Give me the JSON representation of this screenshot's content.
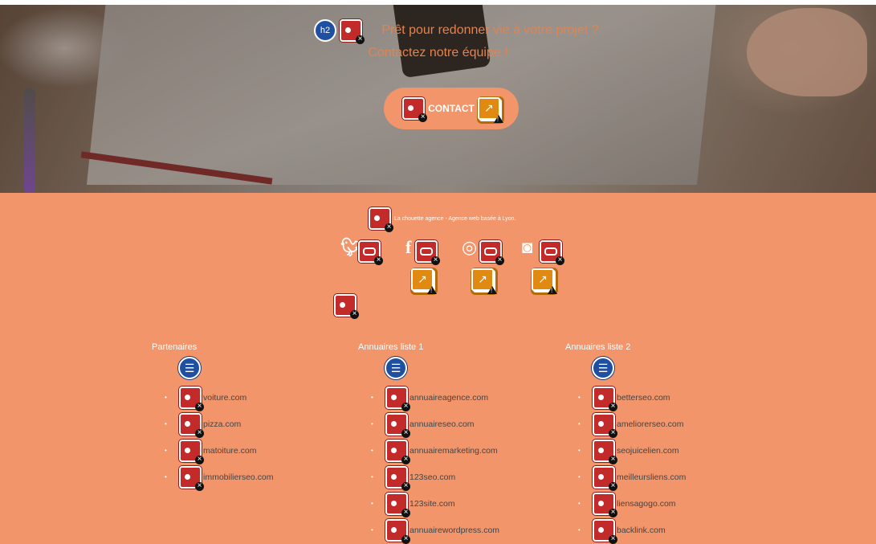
{
  "hero": {
    "heading_badge": "h2",
    "line1": "Prêt pour redonner vie à votre projet ?",
    "line2": "Contactez notre équipe !",
    "cta_label": "CONTACT"
  },
  "footer": {
    "tagline": "La chouette agence - Agence web basée à Lyon.",
    "social": [
      "twitter-icon",
      "facebook-icon",
      "dribbble-icon",
      "instagram-icon"
    ],
    "columns": [
      {
        "title": "Partenaires",
        "items": [
          "voiture.com",
          "pizza.com",
          "matoiture.com",
          "immobilierseo.com"
        ]
      },
      {
        "title": "Annuaires liste 1",
        "items": [
          "annuaireagence.com",
          "annuaireseo.com",
          "annuairemarketing.com",
          "123seo.com",
          "123site.com",
          "annuairewordpress.com"
        ]
      },
      {
        "title": "Annuaires liste 2",
        "items": [
          "betterseo.com",
          "ameliorerseo.com",
          "seojuicelien.com",
          "meilleursliens.com",
          "liensagogo.com",
          "backlink.com"
        ]
      }
    ]
  },
  "colors": {
    "accent": "#f3956a",
    "hero_text": "#e4834e",
    "list_icon": "#1f4fa0",
    "broken_image": "#c32a2a",
    "warning": "#e08a12"
  }
}
